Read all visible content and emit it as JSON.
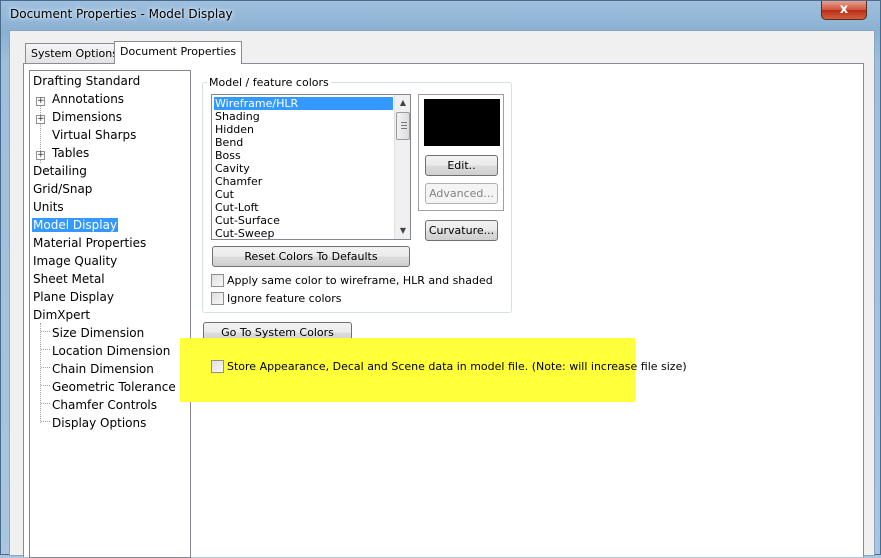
{
  "window": {
    "title": "Document Properties - Model Display",
    "close_glyph": "x"
  },
  "tabs": [
    {
      "label": "System Options",
      "active": false
    },
    {
      "label": "Document Properties",
      "active": true
    }
  ],
  "tree": [
    {
      "label": "Drafting Standard",
      "level": 0,
      "expandable": false,
      "selected": false
    },
    {
      "label": "Annotations",
      "level": 1,
      "expandable": true,
      "selected": false
    },
    {
      "label": "Dimensions",
      "level": 1,
      "expandable": true,
      "selected": false
    },
    {
      "label": "Virtual Sharps",
      "level": 1,
      "expandable": false,
      "selected": false
    },
    {
      "label": "Tables",
      "level": 1,
      "expandable": true,
      "selected": false
    },
    {
      "label": "Detailing",
      "level": 0,
      "expandable": false,
      "selected": false
    },
    {
      "label": "Grid/Snap",
      "level": 0,
      "expandable": false,
      "selected": false
    },
    {
      "label": "Units",
      "level": 0,
      "expandable": false,
      "selected": false
    },
    {
      "label": "Model Display",
      "level": 0,
      "expandable": false,
      "selected": true
    },
    {
      "label": "Material Properties",
      "level": 0,
      "expandable": false,
      "selected": false
    },
    {
      "label": "Image Quality",
      "level": 0,
      "expandable": false,
      "selected": false
    },
    {
      "label": "Sheet Metal",
      "level": 0,
      "expandable": false,
      "selected": false
    },
    {
      "label": "Plane Display",
      "level": 0,
      "expandable": false,
      "selected": false
    },
    {
      "label": "DimXpert",
      "level": 0,
      "expandable": false,
      "selected": false
    },
    {
      "label": "Size Dimension",
      "level": 1,
      "expandable": false,
      "selected": false
    },
    {
      "label": "Location Dimension",
      "level": 1,
      "expandable": false,
      "selected": false
    },
    {
      "label": "Chain Dimension",
      "level": 1,
      "expandable": false,
      "selected": false
    },
    {
      "label": "Geometric Tolerance",
      "level": 1,
      "expandable": false,
      "selected": false
    },
    {
      "label": "Chamfer Controls",
      "level": 1,
      "expandable": false,
      "selected": false
    },
    {
      "label": "Display Options",
      "level": 1,
      "expandable": false,
      "selected": false
    }
  ],
  "colors_group": {
    "label": "Model / feature colors",
    "items": [
      "Wireframe/HLR",
      "Shading",
      "Hidden",
      "Bend",
      "Boss",
      "Cavity",
      "Chamfer",
      "Cut",
      "Cut-Loft",
      "Cut-Surface",
      "Cut-Sweep"
    ],
    "selected_index": 0,
    "swatch_color": "#000000",
    "edit_label": "Edit..",
    "advanced_label": "Advanced...",
    "curvature_label": "Curvature...",
    "reset_label": "Reset Colors To Defaults",
    "apply_same_label": "Apply same color to wireframe, HLR and shaded",
    "ignore_label": "Ignore feature colors"
  },
  "go_to_system_label": "Go To System Colors",
  "store_label": "Store Appearance, Decal and Scene data in model file. (Note: will increase file size)",
  "highlight_color": "#ffff3a",
  "selection_color": "#3399ff"
}
